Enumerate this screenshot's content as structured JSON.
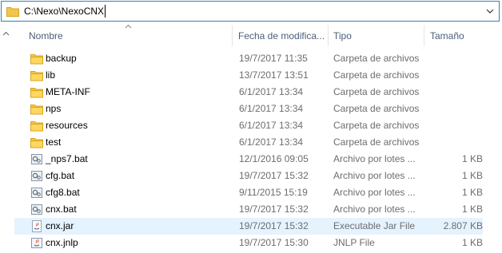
{
  "address_bar": {
    "path": "C:\\Nexo\\NexoCNX"
  },
  "columns": {
    "name": "Nombre",
    "date": "Fecha de modifica...",
    "type": "Tipo",
    "size": "Tamaño"
  },
  "files": [
    {
      "name": "backup",
      "date": "19/7/2017 11:35",
      "type": "Carpeta de archivos",
      "size": "",
      "icon": "folder-icon"
    },
    {
      "name": "lib",
      "date": "13/7/2017 13:51",
      "type": "Carpeta de archivos",
      "size": "",
      "icon": "folder-icon"
    },
    {
      "name": "META-INF",
      "date": "6/1/2017 13:34",
      "type": "Carpeta de archivos",
      "size": "",
      "icon": "folder-icon"
    },
    {
      "name": "nps",
      "date": "6/1/2017 13:34",
      "type": "Carpeta de archivos",
      "size": "",
      "icon": "folder-icon"
    },
    {
      "name": "resources",
      "date": "6/1/2017 13:34",
      "type": "Carpeta de archivos",
      "size": "",
      "icon": "folder-icon"
    },
    {
      "name": "test",
      "date": "6/1/2017 13:34",
      "type": "Carpeta de archivos",
      "size": "",
      "icon": "folder-icon"
    },
    {
      "name": "_nps7.bat",
      "date": "12/1/2016 09:05",
      "type": "Archivo por lotes ...",
      "size": "1 KB",
      "icon": "bat-file-icon"
    },
    {
      "name": "cfg.bat",
      "date": "19/7/2017 15:32",
      "type": "Archivo por lotes ...",
      "size": "1 KB",
      "icon": "bat-file-icon"
    },
    {
      "name": "cfg8.bat",
      "date": "9/11/2015 15:19",
      "type": "Archivo por lotes ...",
      "size": "1 KB",
      "icon": "bat-file-icon"
    },
    {
      "name": "cnx.bat",
      "date": "19/7/2017 15:32",
      "type": "Archivo por lotes ...",
      "size": "1 KB",
      "icon": "bat-file-icon"
    },
    {
      "name": "cnx.jar",
      "date": "19/7/2017 15:32",
      "type": "Executable Jar File",
      "size": "2.807 KB",
      "icon": "java-jar-icon",
      "highlighted": true
    },
    {
      "name": "cnx.jnlp",
      "date": "19/7/2017 15:30",
      "type": "JNLP File",
      "size": "1 KB",
      "icon": "java-jnlp-icon"
    }
  ],
  "colors": {
    "address_border": "#3c7fb1",
    "header_text": "#4c607a",
    "secondary_text": "#6d6d6d",
    "row_highlight": "#e5f3ff",
    "folder_yellow": "#f3c54a"
  }
}
